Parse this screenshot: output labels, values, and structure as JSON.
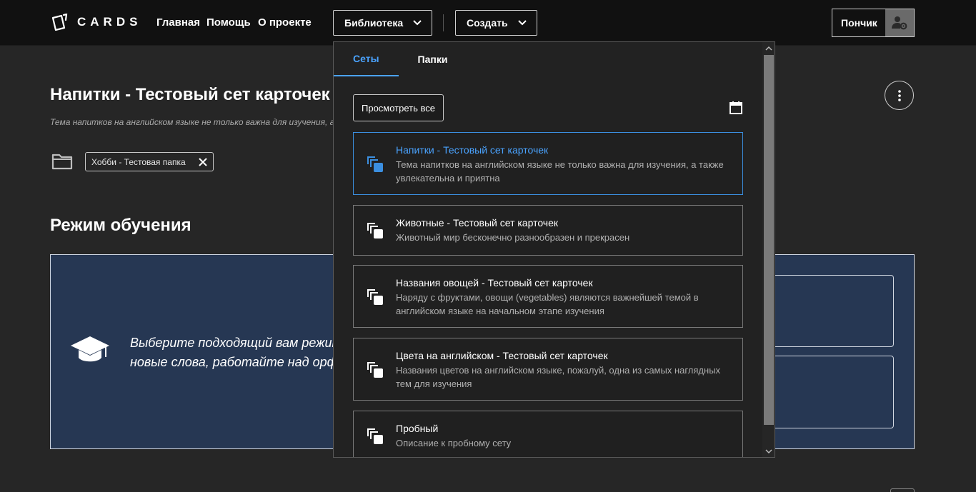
{
  "header": {
    "logo_text": "CARDS",
    "nav_links": [
      "Главная",
      "Помощь",
      "О проекте"
    ],
    "library_label": "Библиотека",
    "create_label": "Создать",
    "user_name": "Пончик"
  },
  "page": {
    "title": "Напитки - Тестовый сет карточек",
    "description": "Тема напитков на английском языке не только важна для изучения, а также увлекательна и приятна",
    "folder_chip": "Хобби - Тестовая папка",
    "section_title": "Режим обучения",
    "study_text_line1": "Выберите подходящий вам режим обучения, чтобы запоминать",
    "study_text_line2": "новые слова, работайте над орфографией"
  },
  "dropdown": {
    "tabs": [
      "Сеты",
      "Папки"
    ],
    "active_tab": "Сеты",
    "view_all_label": "Просмотреть все",
    "sets": [
      {
        "title": "Напитки - Тестовый сет карточек",
        "description": "Тема напитков на английском языке не только важна для изучения, а также увлекательна и приятна",
        "active": true
      },
      {
        "title": "Животные - Тестовый сет карточек",
        "description": "Животный мир бесконечно разнообразен и прекрасен",
        "active": false
      },
      {
        "title": "Названия овощей - Тестовый сет карточек",
        "description": "Наряду с фруктами, овощи (vegetables) являются важнейшей темой в английском языке на начальном этапе изучения",
        "active": false
      },
      {
        "title": "Цвета на английском - Тестовый сет карточек",
        "description": "Названия цветов на английском языке, пожалуй, одна из самых наглядных тем для изучения",
        "active": false
      },
      {
        "title": "Пробный",
        "description": "Описание к пробному сету",
        "active": false
      }
    ]
  },
  "colors": {
    "accent": "#4aa3ff",
    "topbar": "#111111",
    "background": "#262626",
    "study_panel": "#263753"
  },
  "icons": [
    "cards-logo-icon",
    "chevron-down-icon",
    "user-settings-icon",
    "kebab-menu-icon",
    "folder-icon",
    "close-icon",
    "graduation-cap-icon",
    "calendar-icon",
    "card-stack-icon"
  ]
}
